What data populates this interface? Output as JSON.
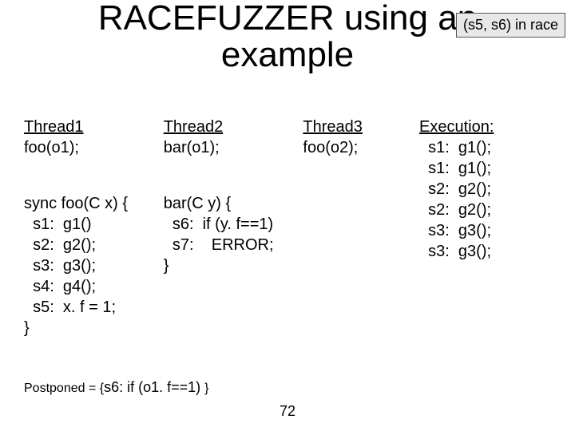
{
  "title_line1": "RACEFUZZER using an",
  "title_line2": "example",
  "badge": "(s5, s6) in race",
  "thread1": {
    "header": "Thread1",
    "call": "foo(o1);",
    "sig": "sync foo(C x) {",
    "s1": "  s1:  g1()",
    "s2": "  s2:  g2();",
    "s3": "  s3:  g3();",
    "s4": "  s4:  g4();",
    "s5": "  s5:  x. f = 1;",
    "close": "}"
  },
  "thread2": {
    "header": "Thread2",
    "call": "bar(o1);",
    "sig": "bar(C y) {",
    "s6": "  s6:  if (y. f==1)",
    "s7": "  s7:    ERROR;",
    "close": "}"
  },
  "thread3": {
    "header": "Thread3",
    "call": "foo(o2);"
  },
  "execution": {
    "header": "Execution:",
    "l1": "  s1:  g1();",
    "l2": "  s1:  g1();",
    "l3": "  s2:  g2();",
    "l4": "  s2:  g2();",
    "l5": "  s3:  g3();",
    "l6": "  s3:  g3();"
  },
  "postponed_label": "Postponed = {",
  "postponed_body": "s6:  if (o1. f==1) ",
  "postponed_close": "}",
  "pagenum": "72"
}
